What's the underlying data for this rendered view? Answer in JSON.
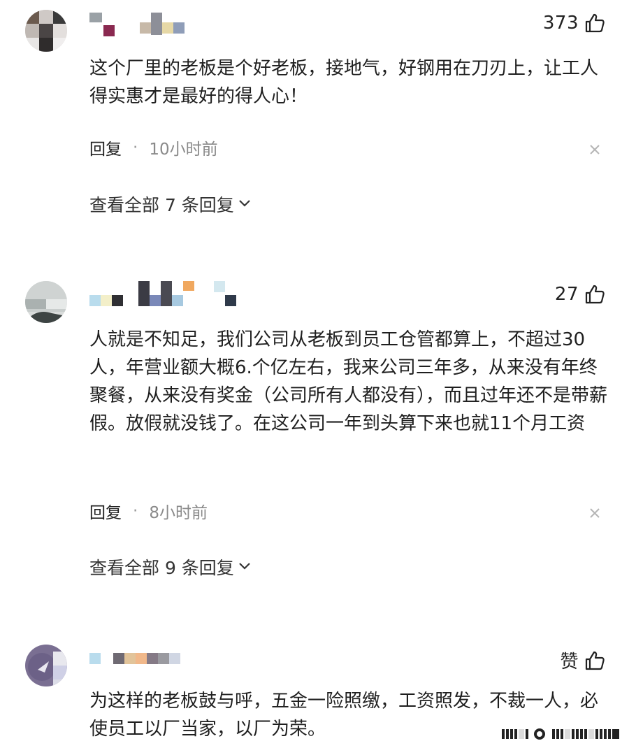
{
  "comments": [
    {
      "like_count": "373",
      "content": "这个厂里的老板是个好老板，接地气，好钢用在刀刃上，让工人得实惠才是最好的得人心！",
      "reply_label": "回复",
      "separator": "·",
      "time": "10小时前",
      "view_all_label": "查看全部 7 条回复"
    },
    {
      "like_count": "27",
      "content": "人就是不知足，我们公司从老板到员工仓管都算上，不超过30人，年营业额大概6.个亿左右，我来公司三年多，从来没有年终聚餐，从来没有奖金（公司所有人都没有），而且过年还不是带薪假。放假就没钱了。在这公司一年到头算下来也就11个月工资",
      "reply_label": "回复",
      "separator": "·",
      "time": "8小时前",
      "view_all_label": "查看全部 9 条回复"
    },
    {
      "like_count": "赞",
      "content": "为这样的老板鼓与呼，五金一险照缴，工资照发，不裁一人，必使员工以厂当家，以厂为荣。"
    }
  ],
  "icons": {
    "like": "thumbs-up-icon",
    "close": "close-icon",
    "expand": "chevron-down-icon"
  },
  "colors": {
    "text_primary": "#222222",
    "text_secondary": "#8a8a8a",
    "background": "#ffffff"
  }
}
